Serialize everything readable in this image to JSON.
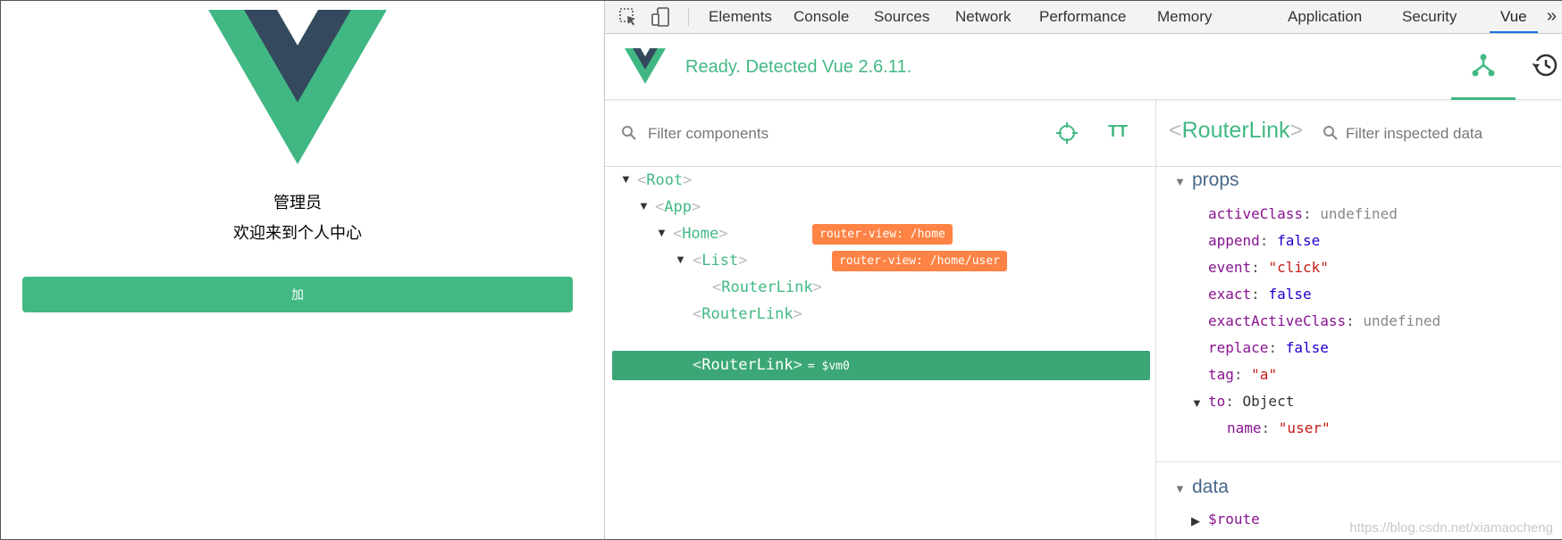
{
  "app": {
    "admin_label": "管理员",
    "welcome_text": "欢迎来到个人中心",
    "add_button": "加"
  },
  "devtools": {
    "tabs": [
      "Elements",
      "Console",
      "Sources",
      "Network",
      "Performance",
      "Memory",
      "Application",
      "Security",
      "Vue"
    ],
    "active_tab": "Vue",
    "more_label": "»",
    "status": "Ready. Detected Vue 2.6.11.",
    "components_filter_placeholder": "Filter components",
    "text_size_label": "TT",
    "tree": [
      {
        "name": "Root",
        "depth": 0,
        "expanded": true
      },
      {
        "name": "App",
        "depth": 1,
        "expanded": true
      },
      {
        "name": "Home",
        "depth": 2,
        "expanded": true,
        "badge": "router-view: /home"
      },
      {
        "name": "List",
        "depth": 3,
        "expanded": true,
        "badge": "router-view: /home/user"
      },
      {
        "name": "RouterLink",
        "depth": 4
      },
      {
        "name": "RouterLink",
        "depth": 3
      },
      {
        "name": "RouterLink",
        "depth": 3,
        "selected": true,
        "vm": "= $vm0"
      }
    ],
    "inspector": {
      "title": "RouterLink",
      "filter_placeholder": "Filter inspected data",
      "sections": {
        "props_title": "props",
        "data_title": "data"
      },
      "props": [
        {
          "key": "activeClass",
          "value": "undefined",
          "kind": "undef"
        },
        {
          "key": "append",
          "value": "false",
          "kind": "bool"
        },
        {
          "key": "event",
          "value": "\"click\"",
          "kind": "str"
        },
        {
          "key": "exact",
          "value": "false",
          "kind": "bool"
        },
        {
          "key": "exactActiveClass",
          "value": "undefined",
          "kind": "undef"
        },
        {
          "key": "replace",
          "value": "false",
          "kind": "bool"
        },
        {
          "key": "tag",
          "value": "\"a\"",
          "kind": "str"
        },
        {
          "key": "to",
          "value": "Object",
          "kind": "obj"
        },
        {
          "key": "name",
          "value": "\"user\"",
          "kind": "str"
        }
      ],
      "data": [
        {
          "key": "$route"
        }
      ]
    }
  },
  "watermark": "https://blog.csdn.net/xiamaocheng",
  "colors": {
    "vue_green": "#42b983",
    "vue_dark": "#35495e",
    "badge": "#ff8344",
    "selected_row": "#3ba776"
  }
}
